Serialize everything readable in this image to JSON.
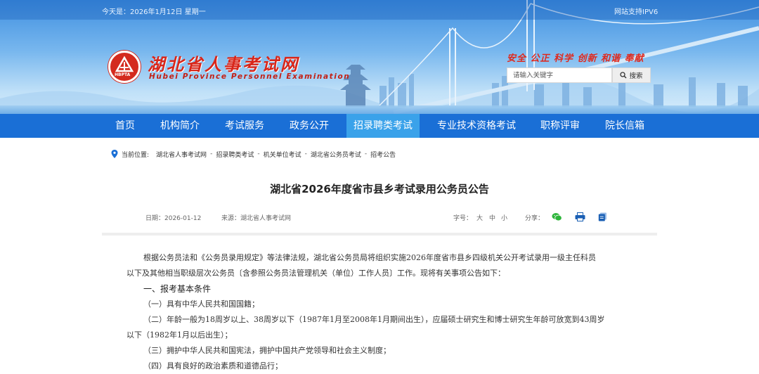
{
  "header": {
    "date_text": "今天是：2026年1月12日 星期一",
    "ipv6_text": "网站支持IPV6",
    "logo_cn": "湖北省人事考试网",
    "logo_en": "Hubei Province Personnel Examination",
    "logo_badge": "HBPTA",
    "slogan": "安全 公正 科学 创新 和谐 奉献",
    "search_placeholder": "请输入关键字",
    "search_button": "搜索"
  },
  "nav": {
    "items": [
      "首页",
      "机构简介",
      "考试服务",
      "政务公开",
      "招录聘类考试",
      "专业技术资格考试",
      "职称评审",
      "院长信箱"
    ],
    "active_index": 4
  },
  "breadcrumb": {
    "label": "当前位置:",
    "items": [
      "湖北省人事考试网",
      "招录聘类考试",
      "机关单位考试",
      "湖北省公务员考试",
      "招考公告"
    ],
    "separator": "-"
  },
  "article": {
    "title": "湖北省2026年度省市县乡考试录用公务员公告",
    "date": "日期：2026-01-12",
    "source": "来源：湖北省人事考试网",
    "font_size_label": "字号：",
    "font_sizes": [
      "大",
      "中",
      "小"
    ],
    "share_label": "分享：",
    "paragraphs": [
      "根据公务员法和《公务员录用规定》等法律法规，湖北省公务员局将组织实施2026年度省市县乡四级机关公开考试录用一级主任科员",
      "以下及其他相当职级层次公务员〔含参照公务员法管理机关（单位）工作人员〕工作。现将有关事项公告如下：",
      "一、报考基本条件",
      "（一）具有中华人民共和国国籍；",
      "（二）年龄一般为18周岁以上、38周岁以下（1987年1月至2008年1月期间出生），应届硕士研究生和博士研究生年龄可放宽到43周岁",
      "以下（1982年1月以后出生）；",
      "（三）拥护中华人民共和国宪法，拥护中国共产党领导和社会主义制度；",
      "（四）具有良好的政治素质和道德品行；"
    ]
  },
  "colors": {
    "nav_bg": "#1a6fd6",
    "nav_active": "#3aa2ea",
    "brand_red": "#d8261a",
    "wechat_green": "#2db53a",
    "share_blue": "#1a5fb4"
  }
}
